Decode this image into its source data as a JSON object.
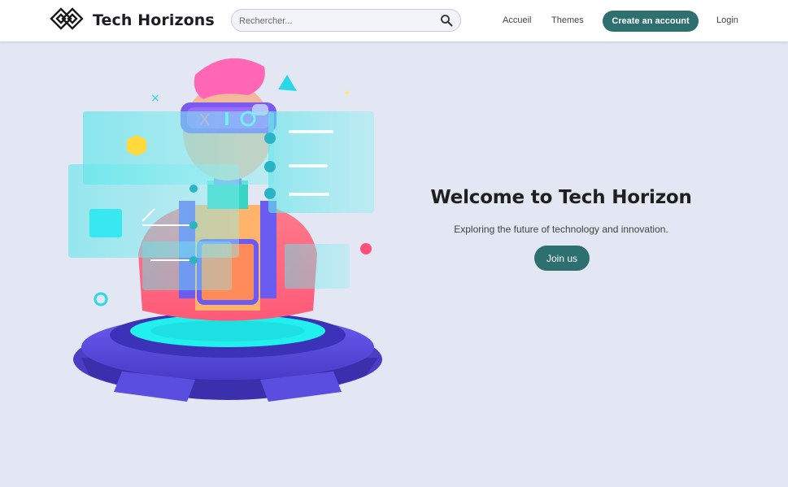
{
  "header": {
    "brand": "Tech Horizons",
    "search_placeholder": "Rechercher...",
    "nav": {
      "home": "Accueil",
      "themes": "Themes",
      "create_account": "Create an account",
      "login": "Login"
    }
  },
  "hero": {
    "title": "Welcome to Tech Horizon",
    "subtitle": "Exploring the future of technology and innovation.",
    "join_label": "Join us"
  },
  "colors": {
    "background": "#e3e6f3",
    "accent": "#2e6f70",
    "header_bg": "#ffffff"
  },
  "icons": {
    "logo": "interlocked-squares-logo",
    "search": "magnifier-icon"
  }
}
